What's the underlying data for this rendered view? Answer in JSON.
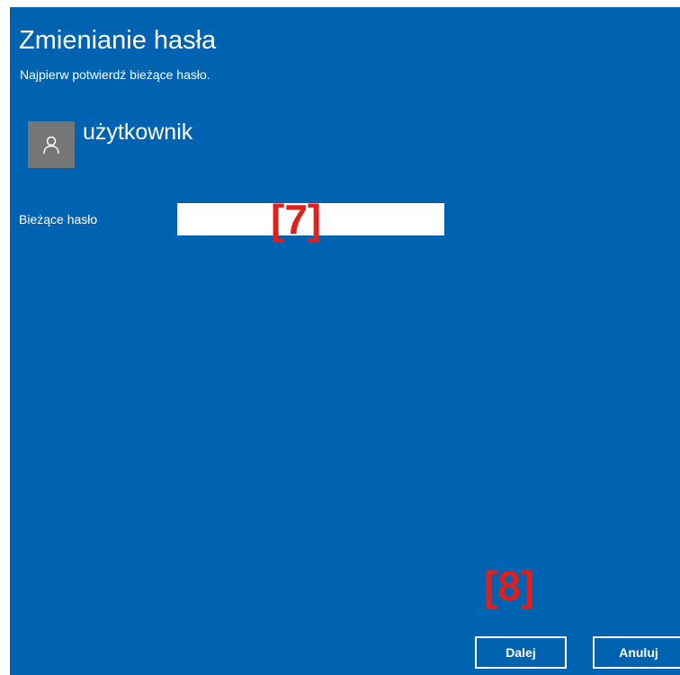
{
  "dialog": {
    "title": "Zmienianie hasła",
    "subtitle": "Najpierw potwierdź bieżące hasło."
  },
  "user": {
    "name": "użytkownik",
    "avatar_icon": "person-icon"
  },
  "password_field": {
    "label": "Bieżące hasło",
    "value": "",
    "placeholder": ""
  },
  "markers": {
    "field_marker": "[7]",
    "button_marker": "[8]"
  },
  "buttons": {
    "next_label": "Dalej",
    "cancel_label": "Anuluj"
  },
  "colors": {
    "dialog_background": "#0063b1",
    "avatar_background": "#767676",
    "marker_color": "#e0201c"
  }
}
